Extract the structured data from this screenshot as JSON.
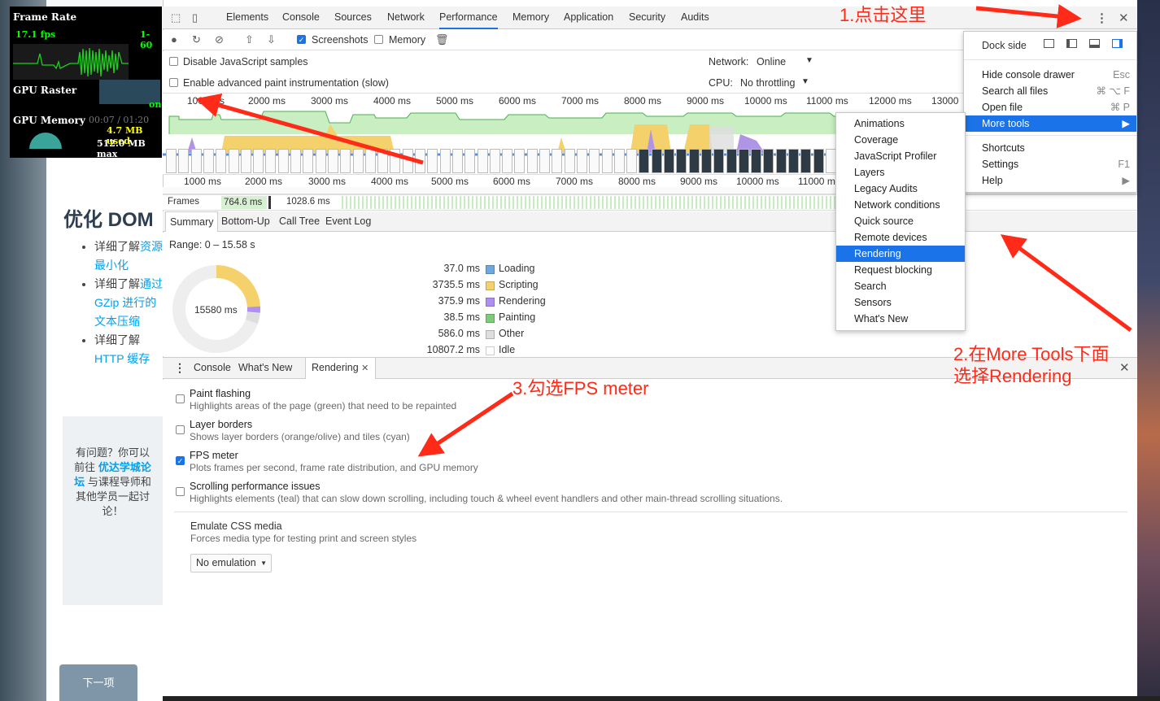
{
  "page": {
    "title": "优化 DOM",
    "list": [
      {
        "prefix": "详细了解",
        "link": "资源最小化"
      },
      {
        "prefix": "详细了解",
        "link": "通过 GZip 进行的文本压缩"
      },
      {
        "prefix": "详细了解",
        "link": "HTTP 缓存"
      }
    ],
    "help_prefix": "有问题？你可以前往",
    "help_link": "优达学城论坛",
    "help_suffix": "与课程导师和其他学员一起讨论！",
    "next_label": "下一项"
  },
  "fps_meter": {
    "frame_rate_label": "Frame Rate",
    "fps": "17.1 fps",
    "range": "1-60",
    "gpu_raster_label": "GPU Raster",
    "gpu_raster_status": "on",
    "gpu_memory_label": "GPU Memory",
    "ghost_time": "00:07 / 01:20",
    "mem_used": "4.7 MB used",
    "mem_max": "512.0 MB max"
  },
  "devtools": {
    "tabs": [
      "Elements",
      "Console",
      "Sources",
      "Network",
      "Performance",
      "Memory",
      "Application",
      "Security",
      "Audits"
    ],
    "selected_tab": "Performance",
    "toolbar": {
      "screenshots": "Screenshots",
      "memory": "Memory"
    },
    "options": {
      "disable_js": "Disable JavaScript samples",
      "advanced_paint": "Enable advanced paint instrumentation (slow)",
      "network_label": "Network:",
      "network_value": "Online",
      "cpu_label": "CPU:",
      "cpu_value": "No throttling"
    },
    "ruler_top": [
      "1000 ms",
      "2000 ms",
      "3000 ms",
      "4000 ms",
      "5000 ms",
      "6000 ms",
      "7000 ms",
      "8000 ms",
      "9000 ms",
      "10000 ms",
      "11000 ms",
      "12000 ms",
      "13000"
    ],
    "ruler_bottom": [
      "1000 ms",
      "2000 ms",
      "3000 ms",
      "4000 ms",
      "5000 ms",
      "6000 ms",
      "7000 ms",
      "8000 ms",
      "9000 ms",
      "10000 ms",
      "11000 ms"
    ],
    "frames": {
      "label": "Frames",
      "v1": "764.6 ms",
      "v2": "1028.6 ms"
    },
    "subtabs": [
      "Summary",
      "Bottom-Up",
      "Call Tree",
      "Event Log"
    ],
    "summary": {
      "range": "Range: 0 – 15.58 s",
      "total": "15580 ms",
      "rows": [
        {
          "ms": "37.0 ms",
          "label": "Loading",
          "color": "#6fa8dc"
        },
        {
          "ms": "3735.5 ms",
          "label": "Scripting",
          "color": "#f4d16b"
        },
        {
          "ms": "375.9 ms",
          "label": "Rendering",
          "color": "#af8ff2"
        },
        {
          "ms": "38.5 ms",
          "label": "Painting",
          "color": "#7ecb7b"
        },
        {
          "ms": "586.0 ms",
          "label": "Other",
          "color": "#dedede"
        },
        {
          "ms": "10807.2 ms",
          "label": "Idle",
          "color": "#ffffff"
        }
      ]
    },
    "drawer_tabs": [
      "Console",
      "What's New",
      "Rendering"
    ],
    "rendering": {
      "options": [
        {
          "title": "Paint flashing",
          "desc": "Highlights areas of the page (green) that need to be repainted",
          "checked": false
        },
        {
          "title": "Layer borders",
          "desc": "Shows layer borders (orange/olive) and tiles (cyan)",
          "checked": false
        },
        {
          "title": "FPS meter",
          "desc": "Plots frames per second, frame rate distribution, and GPU memory",
          "checked": true
        },
        {
          "title": "Scrolling performance issues",
          "desc": "Highlights elements (teal) that can slow down scrolling, including touch & wheel event handlers and other main-thread scrolling situations.",
          "checked": false
        }
      ],
      "emulate_title": "Emulate CSS media",
      "emulate_desc": "Forces media type for testing print and screen styles",
      "emulate_value": "No emulation"
    }
  },
  "main_menu": {
    "dock_side": "Dock side",
    "items": [
      {
        "label": "Hide console drawer",
        "shortcut": "Esc"
      },
      {
        "label": "Search all files",
        "shortcut": "⌘ ⌥ F"
      },
      {
        "label": "Open file",
        "shortcut": "⌘ P"
      },
      {
        "label": "More tools",
        "shortcut": "▶"
      },
      {
        "label": "Shortcuts",
        "shortcut": ""
      },
      {
        "label": "Settings",
        "shortcut": "F1"
      },
      {
        "label": "Help",
        "shortcut": "▶"
      }
    ]
  },
  "more_tools": [
    "Animations",
    "Coverage",
    "JavaScript Profiler",
    "Layers",
    "Legacy Audits",
    "Network conditions",
    "Quick source",
    "Remote devices",
    "Rendering",
    "Request blocking",
    "Search",
    "Sensors",
    "What's New"
  ],
  "highlighted_tool": "Rendering",
  "annotations": {
    "step1": "1.点击这里",
    "step2a": "2.在More Tools下面",
    "step2b": "选择Rendering",
    "step3": "3.勾选FPS meter"
  }
}
